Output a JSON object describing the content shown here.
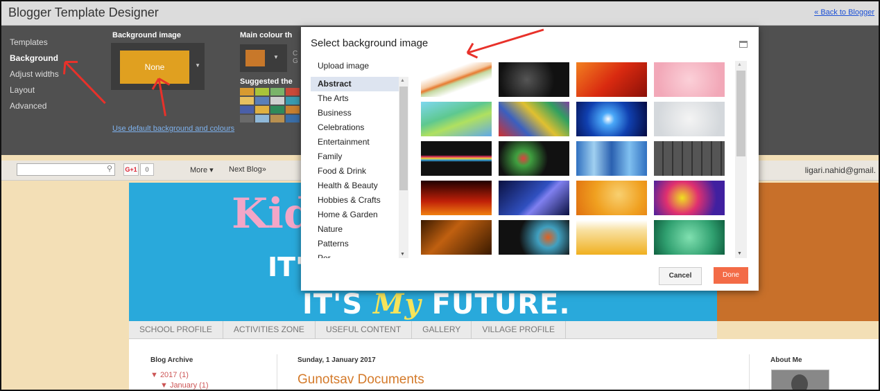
{
  "designer": {
    "title": "Blogger Template Designer",
    "back_link": "« Back to Blogger",
    "nav": [
      "Templates",
      "Background",
      "Adjust widths",
      "Layout",
      "Advanced"
    ],
    "active_nav": "Background",
    "background_image_label": "Background image",
    "background_image_value": "None",
    "main_colour_label": "Main colour th",
    "main_colour_hex": "#c8782a",
    "cropped_text": [
      "C",
      "G"
    ],
    "suggested_label": "Suggested the",
    "use_default_link": "Use default background and colours"
  },
  "navbar": {
    "search_placeholder": "",
    "gplus": "G+1",
    "gplus_count": "0",
    "more": "More ▾",
    "next_blog": "Next Blog»",
    "user_email": "ligari.nahid@gmail."
  },
  "blog": {
    "header_title": "Kid",
    "header_line2": "IT'",
    "header_line3_a": "IT'S",
    "header_line3_my": "My",
    "header_line3_b": "FUTURE.",
    "menu": [
      "SCHOOL PROFILE",
      "ACTIVITIES ZONE",
      "USEFUL CONTENT",
      "GALLERY",
      "VILLAGE PROFILE"
    ],
    "archive_title": "Blog Archive",
    "archive_year": "▼ 2017 (1)",
    "archive_month": "▼ January (1)",
    "post_date": "Sunday, 1 January 2017",
    "post_title": "Gunotsav Documents",
    "about_title": "About Me"
  },
  "dialog": {
    "title": "Select background image",
    "upload_link": "Upload image",
    "categories": [
      "Abstract",
      "The Arts",
      "Business",
      "Celebrations",
      "Entertainment",
      "Family",
      "Food & Drink",
      "Health & Beauty",
      "Hobbies & Crafts",
      "Home & Garden",
      "Nature",
      "Patterns",
      "Per..."
    ],
    "selected_category": "Abstract",
    "cancel_label": "Cancel",
    "done_label": "Done",
    "done_color": "#f36b47"
  }
}
